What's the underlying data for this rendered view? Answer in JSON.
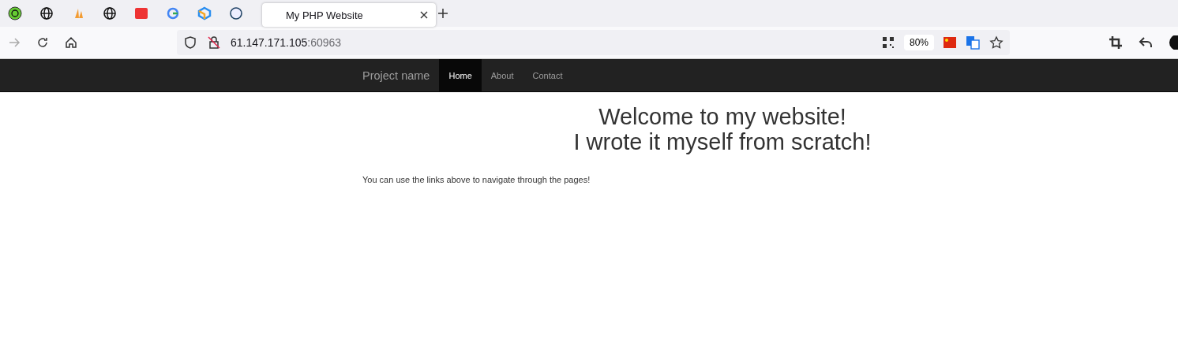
{
  "browser": {
    "tabs": [
      {
        "title": "My PHP Website",
        "selected": true
      }
    ],
    "address": {
      "host": "61.147.171.105",
      "port": ":60963"
    },
    "zoom": "80%"
  },
  "navbar": {
    "brand": "Project name",
    "links": [
      {
        "label": "Home",
        "selected": true
      },
      {
        "label": "About",
        "selected": false
      },
      {
        "label": "Contact",
        "selected": false
      }
    ]
  },
  "page": {
    "headings": [
      "Welcome to my website!",
      "I wrote it myself from scratch!"
    ],
    "text": "You can use the links above to navigate through the pages!"
  }
}
